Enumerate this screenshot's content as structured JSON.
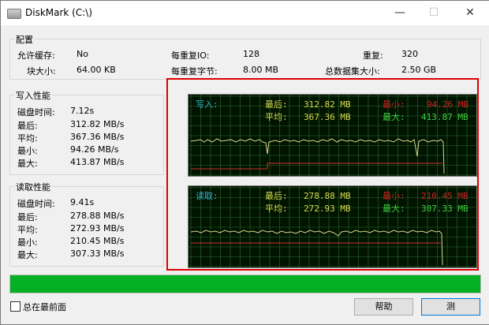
{
  "window": {
    "title": "DiskMark (C:\\)",
    "minimize": "—",
    "maximize": "☐",
    "close": "✕"
  },
  "config": {
    "title": "配置",
    "allow_cache_label": "允许缓存:",
    "allow_cache_value": "No",
    "io_per_repeat_label": "每重复IO:",
    "io_per_repeat_value": "128",
    "repeat_label": "重复:",
    "repeat_value": "320",
    "block_size_label": "块大小:",
    "block_size_value": "64.00 KB",
    "bytes_per_repeat_label": "每重复字节:",
    "bytes_per_repeat_value": "8.00 MB",
    "total_data_label": "总数据集大小:",
    "total_data_value": "2.50 GB"
  },
  "write": {
    "title": "写入性能",
    "disk_time_label": "磁盘时间:",
    "disk_time_value": "7.12s",
    "last_label": "最后:",
    "last_value": "312.82 MB/s",
    "avg_label": "平均:",
    "avg_value": "367.36 MB/s",
    "min_label": "最小:",
    "min_value": "94.26 MB/s",
    "max_label": "最大:",
    "max_value": "413.87 MB/s",
    "chart": {
      "mode": "写入:",
      "last_label": "最后:",
      "last": "312.82 MB",
      "avg_label": "平均:",
      "avg": "367.36 MB",
      "min_label": "最小:",
      "min": "94.26 MB",
      "max_label": "最大:",
      "max": "413.87 MB"
    }
  },
  "read": {
    "title": "读取性能",
    "disk_time_label": "磁盘时间:",
    "disk_time_value": "9.41s",
    "last_label": "最后:",
    "last_value": "278.88 MB/s",
    "avg_label": "平均:",
    "avg_value": "272.93 MB/s",
    "min_label": "最小:",
    "min_value": "210.45 MB/s",
    "max_label": "最大:",
    "max_value": "307.33 MB/s",
    "chart": {
      "mode": "读取:",
      "last_label": "最后:",
      "last": "278.88 MB",
      "avg_label": "平均:",
      "avg": "272.93 MB",
      "min_label": "最小:",
      "min": "210.45 MB",
      "max_label": "最大:",
      "max": "307.33 MB"
    }
  },
  "progress": {
    "fraction": 1.0
  },
  "footer": {
    "always_on_top": "总在最前面",
    "help_button": "帮助",
    "test_button": "测"
  },
  "colors": {
    "chart_bg": "#001400",
    "grid": "#2f6b2f",
    "trace": "#d8d890",
    "minline": "#d03030",
    "label_green": "#40d040",
    "label_yellow": "#d8d850",
    "label_red": "#d02020",
    "label_cyan": "#30b0d0"
  }
}
